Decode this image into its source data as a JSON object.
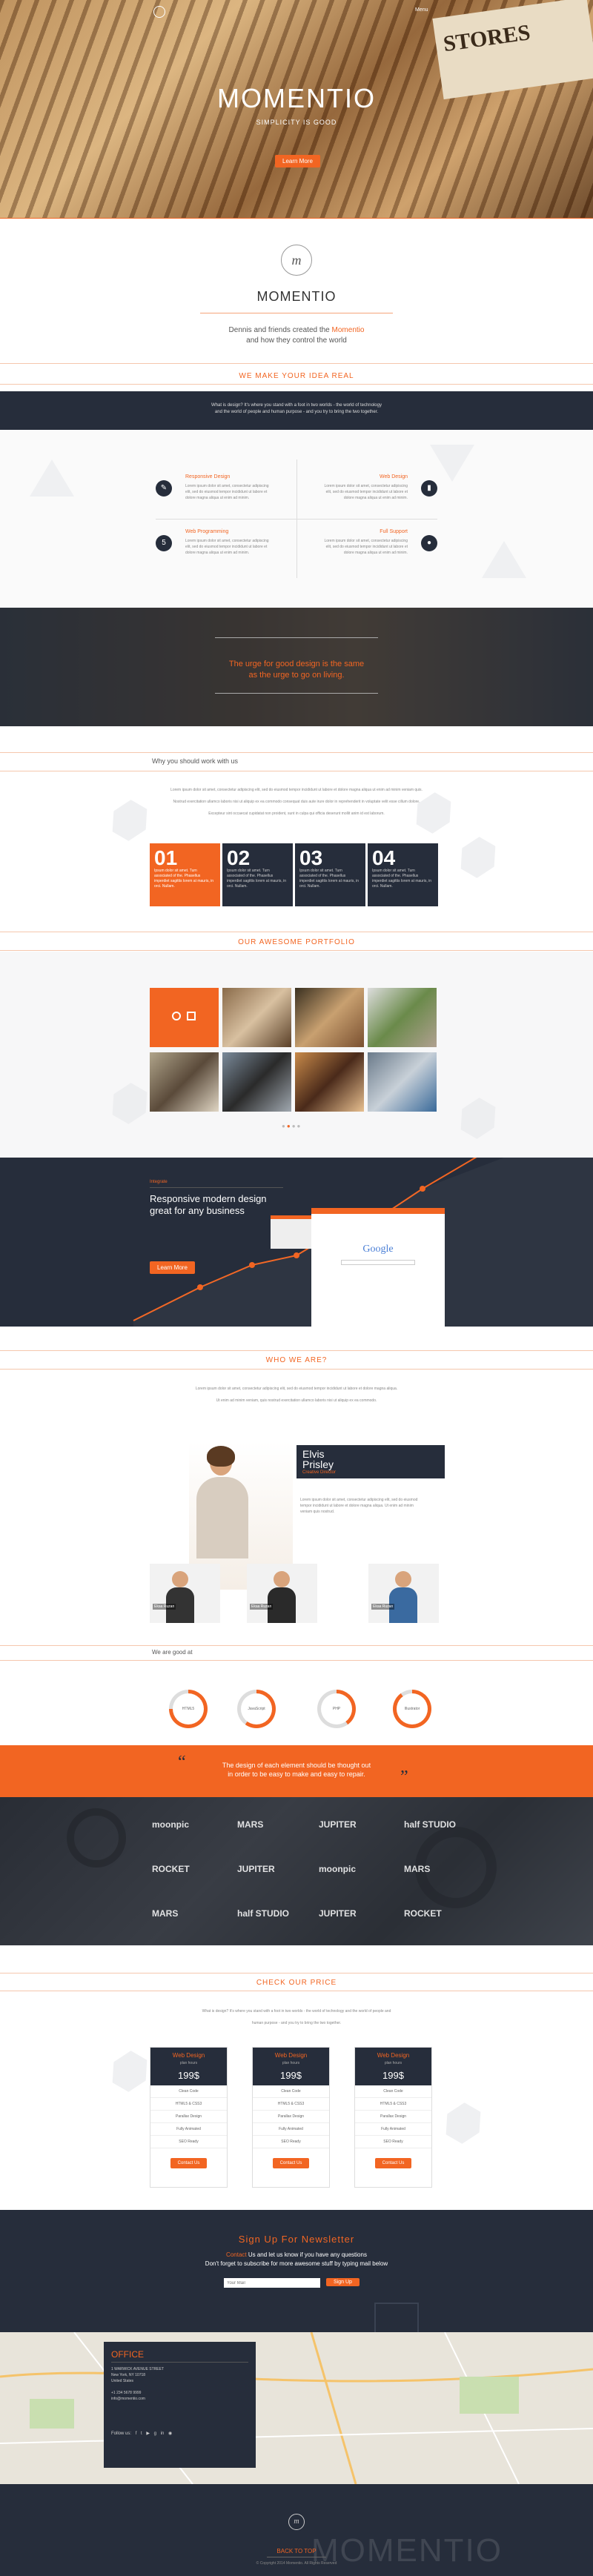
{
  "hero": {
    "top_label": "Menu",
    "corner_text": "STORES",
    "title": "MOMENTIO",
    "subtitle": "SIMPLICITY IS GOOD",
    "button": "Learn More"
  },
  "intro": {
    "brand": "MOMENTIO",
    "line1_pre": "Dennis and friends created the ",
    "line1_link": "Momentio",
    "line2": "and how they control the world"
  },
  "idea": {
    "heading": "WE MAKE YOUR IDEA REAL",
    "band_text_1": "What is design? It's where you stand with a foot in two worlds - the world of technology",
    "band_text_2": "and the world of people and human purpose - and you try to bring the two together."
  },
  "features": [
    {
      "title": "Responsive Design",
      "icon": "compass-icon",
      "text": "Lorem ipsum dolor sit amet, consectetur adipiscing elit, sed do eiusmod tempor incididunt ut labore et dolore magna aliqua ut enim ad minim."
    },
    {
      "title": "Web Design",
      "icon": "paint-roller-icon",
      "text": "Lorem ipsum dolor sit amet, consectetur adipiscing elit, sed do eiusmod tempor incididunt ut labore et dolore magna aliqua ut enim ad minim."
    },
    {
      "title": "Web Programming",
      "icon": "html5-icon",
      "text": "Lorem ipsum dolor sit amet, consectetur adipiscing elit, sed do eiusmod tempor incididunt ut labore et dolore magna aliqua ut enim ad minim."
    },
    {
      "title": "Full Support",
      "icon": "chat-icon",
      "text": "Lorem ipsum dolor sit amet, consectetur adipiscing elit, sed do eiusmod tempor incididunt ut labore et dolore magna aliqua ut enim ad minim."
    }
  ],
  "quote": {
    "line1": "The urge for good design is the same",
    "line2": "as the urge to go on living."
  },
  "why": {
    "heading": "Why you should work with us",
    "text1": "Lorem ipsum dolor sit amet, consectetur adipiscing elit, sed do eiusmod tempor incididunt ut labore et dolore magna aliqua ut enim ad minim veniam quis.",
    "text2": "Nostrud exercitation ullamco laboris nisi ut aliquip ex ea commodo consequat duis aute irure dolor in reprehenderit in voluptate velit esse cillum dolore.",
    "text3": "Excepteur sint occaecat cupidatat non proident, sunt in culpa qui officia deserunt mollit anim id est laborum.",
    "steps": [
      {
        "num": "01",
        "text": "Ipsum dolor sit amet. Turn associated of the. Phasellus imperdiet sagittis lorem at mauris, in orci. Nullam."
      },
      {
        "num": "02",
        "text": "Ipsum dolor sit amet. Turn associated of the. Phasellus imperdiet sagittis lorem at mauris, in orci. Nullam."
      },
      {
        "num": "03",
        "text": "Ipsum dolor sit amet. Turn associated of the. Phasellus imperdiet sagittis lorem at mauris, in orci. Nullam."
      },
      {
        "num": "04",
        "text": "Ipsum dolor sit amet. Turn associated of the. Phasellus imperdiet sagittis lorem at mauris, in orci. Nullam."
      }
    ]
  },
  "portfolio": {
    "heading": "OUR AWESOME PORTFOLIO"
  },
  "growth": {
    "tag": "Integrate",
    "title1": "Responsive modern design",
    "title2": "great for any business",
    "button": "Learn More",
    "search_brand": "Google"
  },
  "who": {
    "heading": "WHO WE ARE?",
    "text1": "Lorem ipsum dolor sit amet, consectetur adipiscing elit, sed do eiusmod tempor incididunt ut labore et dolore magna aliqua.",
    "text2": "Ut enim ad minim veniam, quis nostrud exercitation ullamco laboris nisi ut aliquip ex ea commodo.",
    "person_first": "Elvis",
    "person_last": "Prisley",
    "person_role": "Creative Director",
    "person_bio": "Lorem ipsum dolor sit amet, consectetur adipiscing elit, sed do eiusmod tempor incididunt ut labore et dolore magna aliqua. Ut enim ad minim veniam quis nostrud.",
    "members": [
      {
        "name": "Ekaa Ruzan",
        "role": "Designer"
      },
      {
        "name": "Ekaa Ruzan",
        "role": "Designer"
      },
      {
        "name": "Ekaa Ruzan",
        "role": "Designer"
      }
    ]
  },
  "skills": {
    "heading": "We are good at",
    "items": [
      {
        "label": "HTML5",
        "pct": 0.75
      },
      {
        "label": "JavaScript",
        "pct": 0.6
      },
      {
        "label": "PHP",
        "pct": 0.4
      },
      {
        "label": "Illustrator",
        "pct": 0.9
      }
    ]
  },
  "testimonial": {
    "line1": "The design of each element should be thought out",
    "line2": "in order to be easy to make and easy to repair."
  },
  "clients": {
    "logos": [
      "moonpic",
      "MARS",
      "JUPITER",
      "half STUDIO",
      "ROCKET",
      "JUPITER",
      "moonpic",
      "MARS",
      "MARS",
      "half STUDIO",
      "JUPITER",
      "ROCKET"
    ]
  },
  "pricing": {
    "heading": "CHECK OUR PRICE",
    "text1": "What is design? It's where you stand with a foot in two worlds - the world of technology and the world of people and",
    "text2": "human purpose - and you try to bring the two together.",
    "plans": [
      {
        "name": "Web Design",
        "sub": "plan hours",
        "price": "199$",
        "rows": [
          "Clean Code",
          "HTML5 & CSS3",
          "Parallax Design",
          "Fully Animated",
          "SEO Ready"
        ],
        "button": "Contact Us"
      },
      {
        "name": "Web Design",
        "sub": "plan hours",
        "price": "199$",
        "rows": [
          "Clean Code",
          "HTML5 & CSS3",
          "Parallax Design",
          "Fully Animated",
          "SEO Ready"
        ],
        "button": "Contact Us"
      },
      {
        "name": "Web Design",
        "sub": "plan hours",
        "price": "199$",
        "rows": [
          "Clean Code",
          "HTML5 & CSS3",
          "Parallax Design",
          "Fully Animated",
          "SEO Ready"
        ],
        "button": "Contact Us"
      }
    ]
  },
  "newsletter": {
    "heading": "Sign Up For Newsletter",
    "line1_link": "Contact",
    "line1_rest": " Us and let us know if you have any questions",
    "line2": "Don't forget to subscribe for more awesome stuff by typing mail below",
    "placeholder": "Your Mail",
    "button": "Sign Up"
  },
  "office": {
    "title": "OFFICE",
    "address1": "1 WARWICK AVENUE STREET",
    "address2": "New York, NY 10718",
    "address3": "United States",
    "phone": "+1 234 5678 9999",
    "email": "info@momentio.com",
    "follow": "Follow us:"
  },
  "footer": {
    "back_top": "BACK TO TOP",
    "copyright": "© Copyright 2014 Momentio. All Rights Reserved",
    "watermark": "MOMENTIO"
  }
}
